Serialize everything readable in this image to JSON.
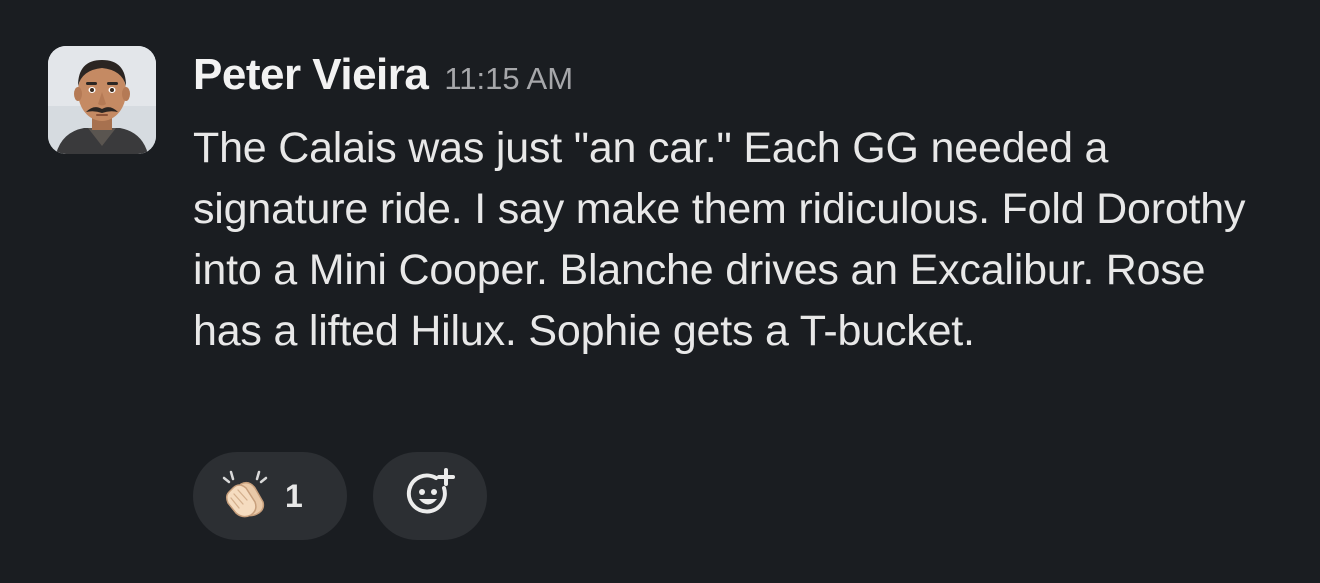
{
  "message": {
    "author": "Peter Vieira",
    "timestamp": "11:15 AM",
    "text": "The Calais was just \"an car.\" Each GG needed a signature ride. I say make them ridiculous. Fold Dorothy into a Mini Cooper. Blanche drives an Excalibur. Rose has a lifted Hilux. Sophie gets a T-bucket."
  },
  "reactions": [
    {
      "icon": "clapping-hands-icon",
      "count": "1"
    }
  ],
  "add_reaction": {
    "icon": "add-reaction-icon"
  },
  "colors": {
    "background": "#1a1d21",
    "reaction_background": "#2c2f33",
    "timestamp": "#a6a7aa",
    "text": "#e8e8e8"
  }
}
